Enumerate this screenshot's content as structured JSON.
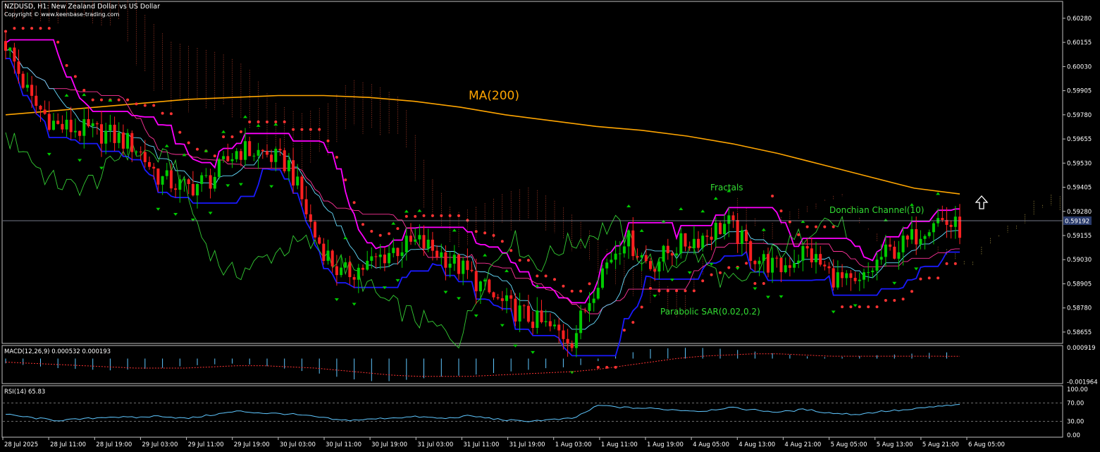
{
  "window": {
    "title": "NZDUSD, H1:  New Zealand Dollar vs US Dollar",
    "copyright": "Copyright © www.keenbase-trading.com"
  },
  "chart_data": [
    {
      "type": "line",
      "panel": "price",
      "y_ticks": [
        "0.60280",
        "0.60155",
        "0.60030",
        "0.59905",
        "0.59780",
        "0.59655",
        "0.59530",
        "0.59405",
        "0.59280",
        "0.59155",
        "0.59030",
        "0.58905",
        "0.58780",
        "0.58655"
      ],
      "ylim": [
        0.586,
        0.6036
      ],
      "current_price": "0.59192",
      "x_ticks": [
        "28 Jul 2025",
        "28 Jul 11:00",
        "28 Jul 19:00",
        "29 Jul 03:00",
        "29 Jul 11:00",
        "29 Jul 19:00",
        "30 Jul 03:00",
        "30 Jul 11:00",
        "30 Jul 19:00",
        "31 Jul 03:00",
        "31 Jul 11:00",
        "31 Jul 19:00",
        "1 Aug 03:00",
        "1 Aug 11:00",
        "1 Aug 19:00",
        "4 Aug 05:00",
        "4 Aug 13:00",
        "4 Aug 21:00",
        "5 Aug 05:00",
        "5 Aug 13:00",
        "5 Aug 21:00",
        "6 Aug 05:00"
      ],
      "series": [
        {
          "name": "MA(200)",
          "color": "#ffa500",
          "values": [
            0.5978,
            0.598,
            0.5982,
            0.5984,
            0.5986,
            0.5987,
            0.5988,
            0.5988,
            0.5987,
            0.5985,
            0.5982,
            0.5978,
            0.5975,
            0.5972,
            0.597,
            0.5967,
            0.5963,
            0.5958,
            0.5952,
            0.5946,
            0.594,
            0.5937
          ]
        },
        {
          "name": "Donchian Channel(10)",
          "color": "#ff00ff"
        },
        {
          "name": "Parabolic SAR(0.02,0.2)",
          "color": "#ff3333"
        },
        {
          "name": "Fractals",
          "color": "#00cc00"
        }
      ],
      "close": [
        0.6015,
        0.5985,
        0.5972,
        0.597,
        0.5968,
        0.5962,
        0.5945,
        0.594,
        0.5945,
        0.596,
        0.5958,
        0.5952,
        0.5915,
        0.5895,
        0.59,
        0.5908,
        0.5912,
        0.5905,
        0.5895,
        0.5882,
        0.5875,
        0.5868,
        0.5862,
        0.5895,
        0.5915,
        0.59,
        0.591,
        0.5915,
        0.5922,
        0.5905,
        0.5898,
        0.5908,
        0.5895,
        0.5888,
        0.5905,
        0.5912,
        0.5925,
        0.5919
      ]
    },
    {
      "type": "bar",
      "panel": "macd",
      "label": "MACD(12,26,9) 0.000532 0.000193",
      "y_ticks": [
        "0.000919",
        "-0.001964"
      ],
      "ylim": [
        -0.00205,
        0.00098
      ],
      "values": [
        -0.0004,
        -0.0006,
        -0.0008,
        -0.0009,
        -0.001,
        -0.0009,
        -0.0008,
        -0.0006,
        -0.0005,
        -0.0004,
        -0.0006,
        -0.0009,
        -0.0012,
        -0.0016,
        -0.0019,
        -0.0019,
        -0.0017,
        -0.0015,
        -0.0014,
        -0.0012,
        -0.001,
        -0.0008,
        -0.0007,
        -0.0002,
        0.0004,
        0.0008,
        0.0009,
        0.0009,
        0.0008,
        0.0006,
        0.0004,
        0.0002,
        0.0001,
        0.0002,
        0.0003,
        0.0004,
        0.0005,
        0.000532
      ],
      "signal": [
        -0.0003,
        -0.0004,
        -0.0005,
        -0.0006,
        -0.0007,
        -0.0008,
        -0.0008,
        -0.0008,
        -0.0007,
        -0.0006,
        -0.0006,
        -0.0007,
        -0.0008,
        -0.001,
        -0.0012,
        -0.0014,
        -0.0015,
        -0.0015,
        -0.0015,
        -0.0014,
        -0.0013,
        -0.0012,
        -0.0011,
        -0.0009,
        -0.0006,
        -0.0003,
        0.0,
        0.0002,
        0.0003,
        0.0004,
        0.0004,
        0.0003,
        0.0002,
        0.0002,
        0.0002,
        0.0002,
        0.0002,
        0.000193
      ]
    },
    {
      "type": "line",
      "panel": "rsi",
      "label": "RSI(14) 65.83",
      "y_ticks": [
        "100.00",
        "70.00",
        "30.00",
        "0.00"
      ],
      "ylim": [
        0,
        100
      ],
      "levels": [
        70,
        30
      ],
      "values": [
        45,
        38,
        32,
        35,
        40,
        38,
        42,
        36,
        44,
        52,
        48,
        46,
        40,
        32,
        34,
        38,
        40,
        36,
        42,
        35,
        30,
        33,
        36,
        65,
        60,
        58,
        55,
        52,
        60,
        55,
        50,
        56,
        48,
        45,
        52,
        55,
        62,
        65.83
      ]
    }
  ],
  "annotations": {
    "ma": "MA(200)",
    "fractals": "Fractals",
    "donchian": "Donchian Channel(10)",
    "sar": "Parabolic SAR(0.02,0.2)"
  },
  "colors": {
    "background": "#000000",
    "panel_border": "#c0c0c0",
    "text": "#ffffff",
    "ma": "#ffa500",
    "donchian": "#ff00ff",
    "lower_band": "#1a1aff",
    "sar": "#ff3333",
    "bull": "#00cc00",
    "bear": "#ff2020",
    "kijun": "#ff3399",
    "tenkan": "#66ddff",
    "chikou": "#33cc33",
    "cloud_red": "#ff5a3c",
    "cloud_yellow": "#ffe066",
    "macd_hist": "#5fc7ff",
    "macd_signal": "#ff3333",
    "rsi": "#5fc7ff"
  },
  "icons": {
    "arrow": "up-arrow-icon"
  }
}
